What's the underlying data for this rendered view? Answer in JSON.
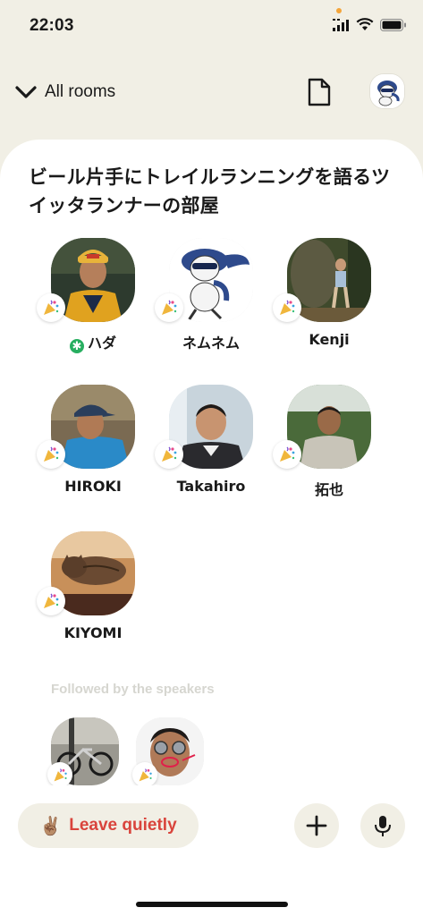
{
  "status_bar": {
    "time": "22:03"
  },
  "nav": {
    "back_label": "All rooms"
  },
  "room": {
    "title": "ビール片手にトレイルランニングを語るツイッタランナーの部屋"
  },
  "speakers": [
    {
      "name": "ハダ",
      "moderator": true
    },
    {
      "name": "ネムネム",
      "moderator": false
    },
    {
      "name": "Kenji",
      "moderator": false
    },
    {
      "name": "HIROKI",
      "moderator": false
    },
    {
      "name": "Takahiro",
      "moderator": false
    },
    {
      "name": "拓也",
      "moderator": false
    },
    {
      "name": "KIYOMI",
      "moderator": false
    }
  ],
  "followed_section": {
    "label": "Followed by the speakers"
  },
  "actions": {
    "leave_label": "Leave quietly",
    "leave_emoji": "✌🏽"
  },
  "colors": {
    "background": "#f1efe5",
    "card": "#ffffff",
    "leave_text": "#d9443c",
    "moderator": "#27ae60"
  },
  "icons": [
    "chevron-down-icon",
    "document-icon",
    "party-popper-icon",
    "plus-icon",
    "microphone-icon"
  ]
}
